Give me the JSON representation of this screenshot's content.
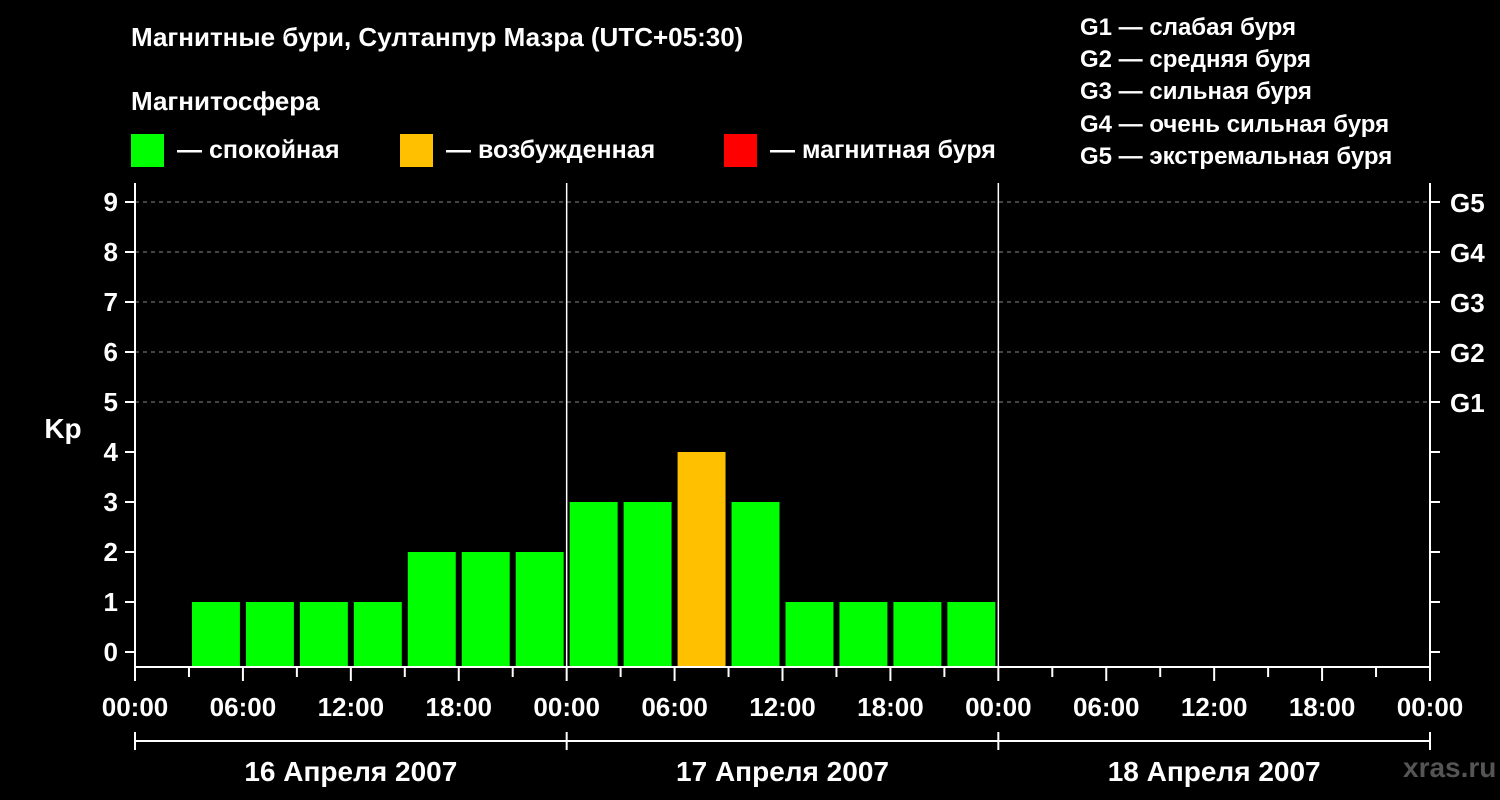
{
  "title": "Магнитные бури, Султанпур Мазра (UTC+05:30)",
  "legend": {
    "title": "Магнитосфера",
    "items": [
      {
        "label": "— спокойная",
        "color": "#00ff00"
      },
      {
        "label": "— возбужденная",
        "color": "#ffc000"
      },
      {
        "label": "— магнитная буря",
        "color": "#ff0000"
      }
    ]
  },
  "g_scale": [
    "G1 — слабая буря",
    "G2 — средняя буря",
    "G3 — сильная буря",
    "G4 — очень сильная буря",
    "G5 — экстремальная буря"
  ],
  "watermark": "xras.ru",
  "chart_data": {
    "type": "bar",
    "ylabel": "Kp",
    "ylim": [
      0,
      9
    ],
    "yticks": [
      "0",
      "1",
      "2",
      "3",
      "4",
      "5",
      "6",
      "7",
      "8",
      "9"
    ],
    "right_labels": [
      {
        "kp": 5,
        "label": "G1"
      },
      {
        "kp": 6,
        "label": "G2"
      },
      {
        "kp": 7,
        "label": "G3"
      },
      {
        "kp": 8,
        "label": "G4"
      },
      {
        "kp": 9,
        "label": "G5"
      }
    ],
    "grid": "dashed horizontal at Kp 5–9",
    "xticks": [
      "00:00",
      "06:00",
      "12:00",
      "18:00",
      "00:00",
      "06:00",
      "12:00",
      "18:00",
      "00:00",
      "06:00",
      "12:00",
      "18:00",
      "00:00"
    ],
    "days": [
      "16 Апреля 2007",
      "17 Апреля 2007",
      "18 Апреля 2007"
    ],
    "bar_interval_hours": 3,
    "series": [
      {
        "values": [
          1,
          1,
          1,
          1,
          2,
          2,
          2,
          3,
          3,
          4,
          3,
          1,
          1,
          1,
          1
        ],
        "colors": [
          "#00ff00",
          "#00ff00",
          "#00ff00",
          "#00ff00",
          "#00ff00",
          "#00ff00",
          "#00ff00",
          "#00ff00",
          "#00ff00",
          "#ffc000",
          "#00ff00",
          "#00ff00",
          "#00ff00",
          "#00ff00",
          "#00ff00"
        ]
      }
    ]
  }
}
